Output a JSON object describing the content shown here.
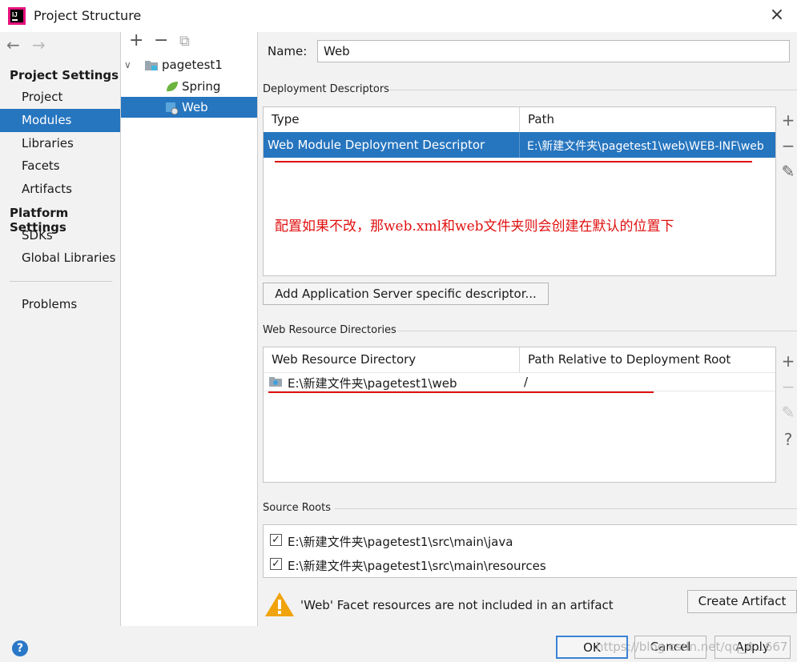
{
  "window": {
    "title": "Project Structure",
    "close_icon": "×"
  },
  "nav": {
    "back_icon": "←",
    "forward_icon": "→",
    "group_project_settings": "Project Settings",
    "items_project": [
      "Project",
      "Modules",
      "Libraries",
      "Facets",
      "Artifacts"
    ],
    "selected_item": "Modules",
    "group_platform_settings": "Platform Settings",
    "items_platform": [
      "SDKs",
      "Global Libraries"
    ],
    "problems": "Problems"
  },
  "tree": {
    "toolbar": {
      "add": "+",
      "remove": "−",
      "copy": "⧉"
    },
    "root": "pagetest1",
    "children": [
      "Spring",
      "Web"
    ],
    "selected": "Web"
  },
  "form": {
    "name_label": "Name:",
    "name_value": "Web"
  },
  "deployment": {
    "section_label": "Deployment Descriptors",
    "col_type": "Type",
    "col_path": "Path",
    "row_type": "Web Module Deployment Descriptor",
    "row_path": "E:\\新建文件夹\\pagetest1\\web\\WEB-INF\\web",
    "annotation": "配置如果不改，那web.xml和web文件夹则会创建在默认的位置下",
    "add_button": "Add Application Server specific descriptor..."
  },
  "resources": {
    "section_label": "Web Resource Directories",
    "col_dir": "Web Resource Directory",
    "col_rel": "Path Relative to Deployment Root",
    "row_dir": "E:\\新建文件夹\\pagetest1\\web",
    "row_rel": "/"
  },
  "sources": {
    "section_label": "Source Roots",
    "roots": [
      {
        "path": "E:\\新建文件夹\\pagetest1\\src\\main\\java",
        "checked": true
      },
      {
        "path": "E:\\新建文件夹\\pagetest1\\src\\main\\resources",
        "checked": true
      }
    ]
  },
  "warning": {
    "text": "'Web' Facet resources are not included in an artifact",
    "action": "Create Artifact"
  },
  "footer": {
    "ok": "OK",
    "cancel": "Cancel",
    "apply": "Apply",
    "watermark": "https://blog.csdn.net/qq_4...667"
  },
  "colors": {
    "selection": "#2675bf",
    "annotation_red": "#e01010",
    "warning_yellow": "#f0a30a"
  }
}
